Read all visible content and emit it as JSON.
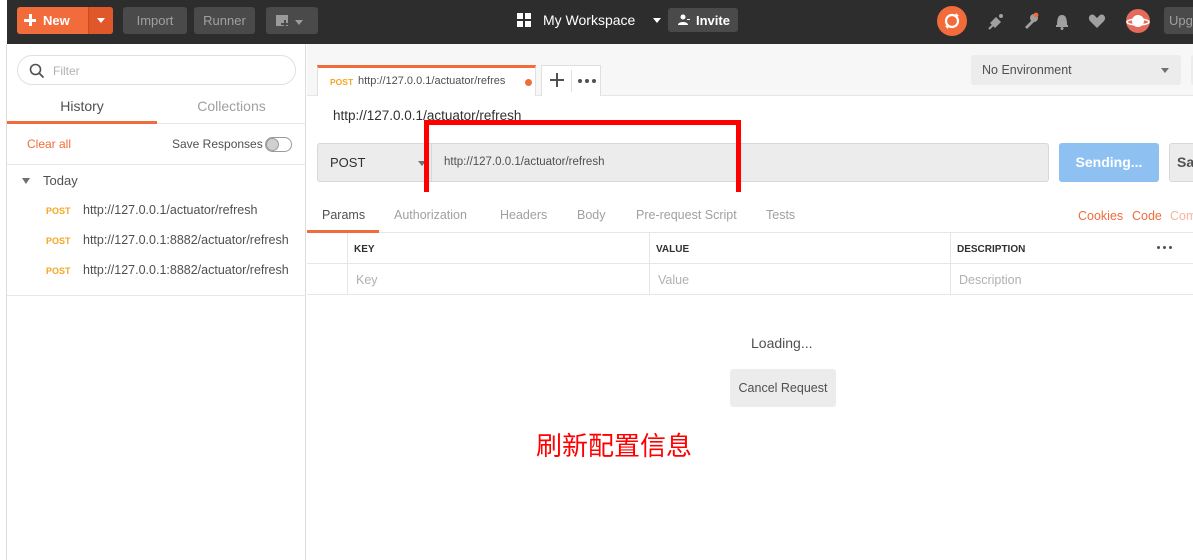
{
  "topbar": {
    "new_label": "New",
    "import_label": "Import",
    "runner_label": "Runner",
    "workspace_label": "My Workspace",
    "invite_label": "Invite",
    "upgrade_label": "Upgrade",
    "accent": "#f26b3a"
  },
  "sidebar": {
    "filter_placeholder": "Filter",
    "tabs": [
      {
        "label": "History"
      },
      {
        "label": "Collections"
      }
    ],
    "clear_label": "Clear all",
    "save_responses_label": "Save Responses",
    "group_label": "Today",
    "history": [
      {
        "method": "POST",
        "url": "http://127.0.0.1/actuator/refresh"
      },
      {
        "method": "POST",
        "url": "http://127.0.0.1:8882/actuator/refresh"
      },
      {
        "method": "POST",
        "url": "http://127.0.0.1:8882/actuator/refresh"
      }
    ]
  },
  "main": {
    "tab": {
      "method": "POST",
      "url": "http://127.0.0.1/actuator/refres"
    },
    "environment": "No Environment",
    "request_name": "http://127.0.0.1/actuator/refresh",
    "method": "POST",
    "url": "http://127.0.0.1/actuator/refresh",
    "send_label": "Sending...",
    "save_label": "Save",
    "subtabs": [
      "Params",
      "Authorization",
      "Headers",
      "Body",
      "Pre-request Script",
      "Tests"
    ],
    "subtabs_right": [
      "Cookies",
      "Code",
      "Comments"
    ],
    "params_table": {
      "headers": [
        "KEY",
        "VALUE",
        "DESCRIPTION"
      ],
      "placeholders": [
        "Key",
        "Value",
        "Description"
      ]
    },
    "loading_label": "Loading...",
    "cancel_label": "Cancel Request",
    "annotation": "刷新配置信息"
  }
}
